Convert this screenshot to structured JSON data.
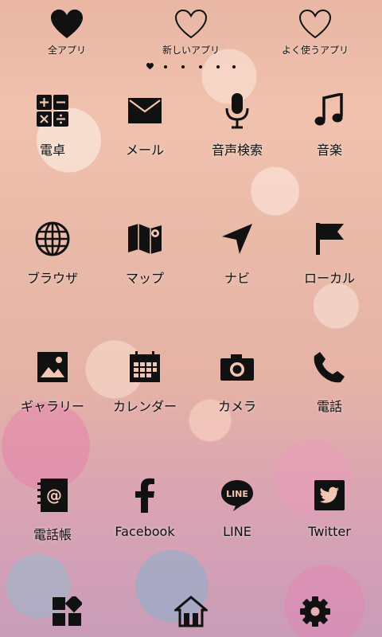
{
  "tabs": [
    {
      "label": "全アプリ",
      "icon": "filled-heart-icon"
    },
    {
      "label": "新しいアプリ",
      "icon": "outline-heart-icon"
    },
    {
      "label": "よく使うアプリ",
      "icon": "outline-heart-icon"
    }
  ],
  "page_indicator": {
    "pages": 6,
    "current": 1
  },
  "apps": [
    {
      "label": "電卓",
      "icon": "calculator-icon"
    },
    {
      "label": "メール",
      "icon": "mail-icon"
    },
    {
      "label": "音声検索",
      "icon": "microphone-icon"
    },
    {
      "label": "音楽",
      "icon": "music-note-icon"
    },
    {
      "label": "ブラウザ",
      "icon": "globe-icon"
    },
    {
      "label": "マップ",
      "icon": "map-icon"
    },
    {
      "label": "ナビ",
      "icon": "navigation-arrow-icon"
    },
    {
      "label": "ローカル",
      "icon": "flag-icon"
    },
    {
      "label": "ギャラリー",
      "icon": "gallery-icon"
    },
    {
      "label": "カレンダー",
      "icon": "calendar-icon"
    },
    {
      "label": "カメラ",
      "icon": "camera-icon"
    },
    {
      "label": "電話",
      "icon": "phone-icon"
    },
    {
      "label": "電話帳",
      "icon": "contacts-icon"
    },
    {
      "label": "Facebook",
      "icon": "facebook-icon"
    },
    {
      "label": "LINE",
      "icon": "line-icon",
      "icon_text": "LINE"
    },
    {
      "label": "Twitter",
      "icon": "twitter-icon"
    }
  ],
  "dock": [
    {
      "icon": "widgets-icon"
    },
    {
      "icon": "home-icon"
    },
    {
      "icon": "settings-icon"
    }
  ]
}
